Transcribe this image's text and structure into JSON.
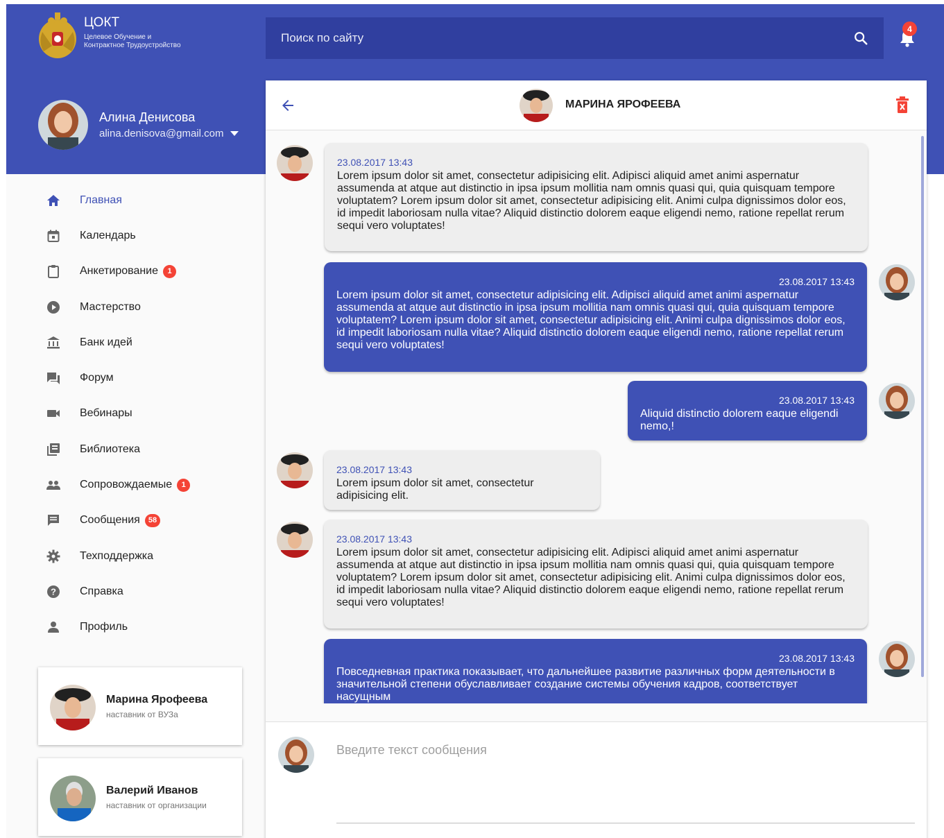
{
  "app": {
    "logo_title": "ЦОКТ",
    "logo_subtitle_line1": "Целевое Обучение и",
    "logo_subtitle_line2": "Контрактное Трудоустройство"
  },
  "search": {
    "placeholder": "Поиск по сайту"
  },
  "notifications": {
    "count": "4"
  },
  "user": {
    "name": "Алина Денисова",
    "email": "alina.denisova@gmail.com"
  },
  "nav": {
    "items": [
      {
        "label": "Главная",
        "icon": "home-icon",
        "active": true
      },
      {
        "label": "Календарь",
        "icon": "calendar-icon"
      },
      {
        "label": "Анкетирование",
        "icon": "clipboard-icon",
        "badge": "1"
      },
      {
        "label": "Мастерство",
        "icon": "play-circle-icon"
      },
      {
        "label": "Банк идей",
        "icon": "bank-icon"
      },
      {
        "label": "Форум",
        "icon": "forum-icon"
      },
      {
        "label": "Вебинары",
        "icon": "videocam-icon"
      },
      {
        "label": "Библиотека",
        "icon": "library-icon"
      },
      {
        "label": "Сопровождаемые",
        "icon": "people-icon",
        "badge": "1"
      },
      {
        "label": "Сообщения",
        "icon": "message-icon",
        "badge": "58"
      },
      {
        "label": "Техподдержка",
        "icon": "gear-icon"
      },
      {
        "label": "Справка",
        "icon": "help-icon"
      },
      {
        "label": "Профиль",
        "icon": "person-icon"
      }
    ]
  },
  "mentors": [
    {
      "name": "Марина Ярофеева",
      "role": "наставник от ВУЗа"
    },
    {
      "name": "Валерий Иванов",
      "role": "наставник от организации"
    }
  ],
  "chat": {
    "contact_name": "МАРИНА ЯРОФЕЕВА",
    "messages": [
      {
        "direction": "in",
        "time": "23.08.2017 13:43",
        "text": "Lorem ipsum dolor sit amet, consectetur adipisicing elit. Adipisci aliquid amet animi aspernatur assumenda at atque aut distinctio in ipsa ipsum mollitia nam omnis quasi qui, quia quisquam tempore voluptatem? Lorem ipsum dolor sit amet, consectetur adipisicing elit. Animi culpa dignissimos dolor eos, id impedit laboriosam nulla vitae? Aliquid distinctio dolorem eaque eligendi nemo, ratione repellat rerum sequi vero voluptates!"
      },
      {
        "direction": "out",
        "time": "23.08.2017 13:43",
        "text": "Lorem ipsum dolor sit amet, consectetur adipisicing elit. Adipisci aliquid amet animi aspernatur assumenda at atque aut distinctio in ipsa ipsum mollitia nam omnis quasi qui, quia quisquam tempore voluptatem? Lorem ipsum dolor sit amet, consectetur adipisicing elit. Animi culpa dignissimos dolor eos, id impedit laboriosam nulla vitae? Aliquid distinctio dolorem eaque eligendi nemo, ratione repellat rerum sequi vero voluptates!"
      },
      {
        "direction": "out",
        "time": "23.08.2017 13:43",
        "text": "Aliquid distinctio dolorem eaque eligendi nemo,!"
      },
      {
        "direction": "in",
        "time": "23.08.2017 13:43",
        "text": "Lorem ipsum dolor sit amet, consectetur adipisicing elit."
      },
      {
        "direction": "in",
        "time": "23.08.2017 13:43",
        "text": "Lorem ipsum dolor sit amet, consectetur adipisicing elit. Adipisci aliquid amet animi aspernatur assumenda at atque aut distinctio in ipsa ipsum mollitia nam omnis quasi qui, quia quisquam tempore voluptatem? Lorem ipsum dolor sit amet, consectetur adipisicing elit. Animi culpa dignissimos dolor eos, id impedit laboriosam nulla vitae? Aliquid distinctio dolorem eaque eligendi nemo, ratione repellat rerum sequi vero voluptates!"
      },
      {
        "direction": "out",
        "time": "23.08.2017 13:43",
        "text": "Повседневная практика показывает, что дальнейшее развитие различных форм деятельности в значительной степени обуславливает создание системы обучения кадров, соответствует насущным"
      }
    ],
    "composer_placeholder": "Введите текст сообщения"
  },
  "colors": {
    "primary": "#3f51b5",
    "primary_dark": "#303f9f",
    "badge": "#f44336",
    "incoming_bubble": "#eeeeee"
  }
}
